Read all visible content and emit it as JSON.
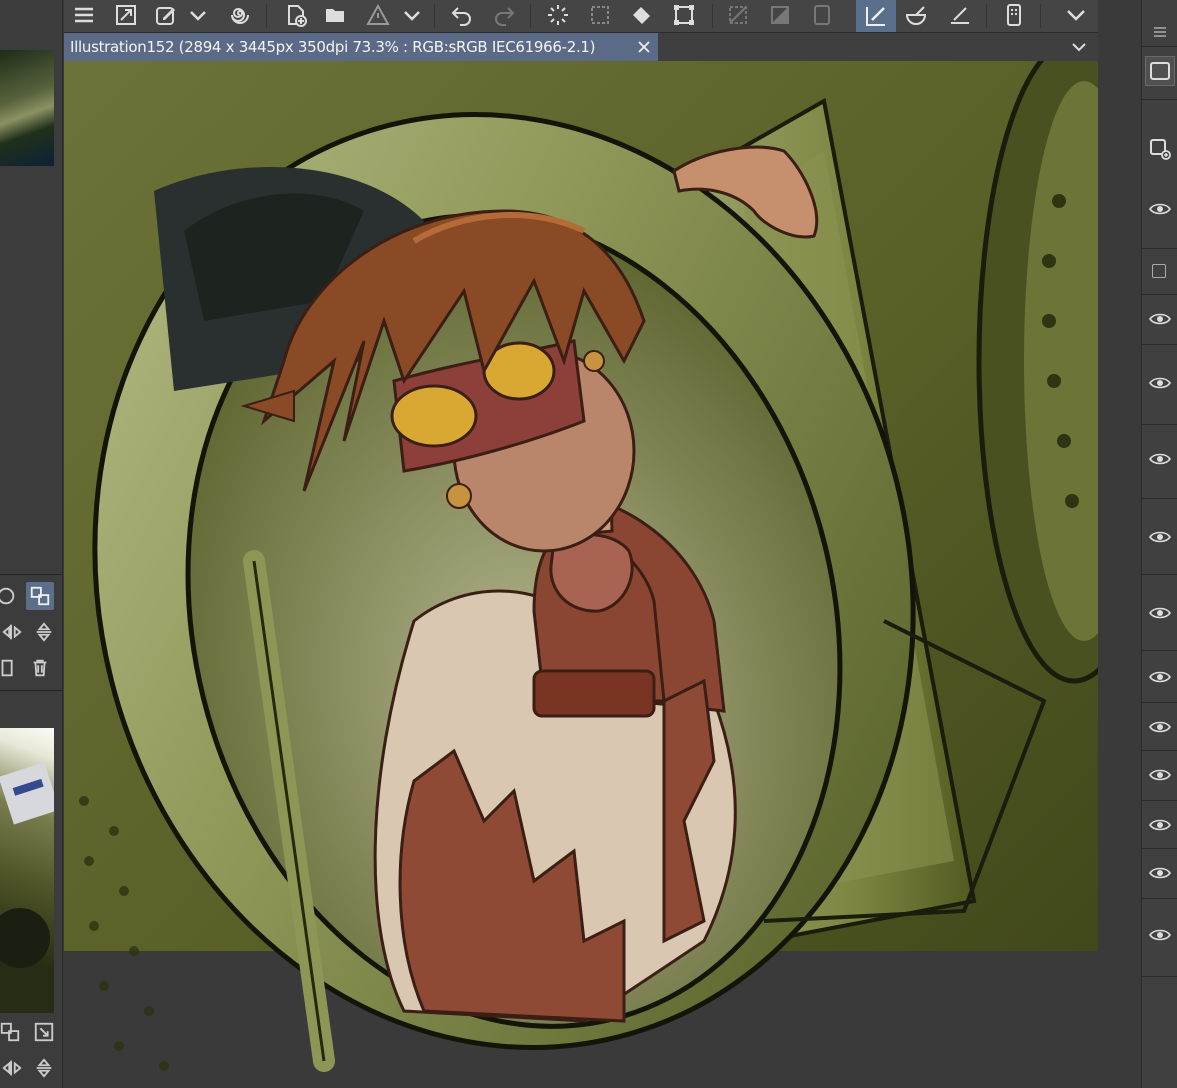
{
  "document": {
    "tab_title": "Illustration152 (2894 x 3445px 350dpi 73.3% : RGB:sRGB IEC61966-2.1)"
  },
  "toolbar": {
    "icons": [
      "menu-icon",
      "resize-icon",
      "edit-layer-icon",
      "dropdown-icon",
      "spiral-icon",
      "new-file-icon",
      "open-folder-icon",
      "warning-icon",
      "dropdown-icon",
      "undo-icon",
      "redo-icon",
      "loading-icon",
      "selection-icon",
      "fill-icon",
      "transform-icon",
      "deselect-icon",
      "gradient-icon",
      "frame-icon",
      "ruler-pen-icon",
      "bowl-icon",
      "ruler-icon",
      "phone-icon",
      "chevron-down-icon"
    ]
  },
  "layers_panel": {
    "rows": [
      "visible",
      "visible",
      "empty",
      "visible",
      "visible",
      "visible",
      "visible",
      "visible",
      "visible",
      "visible",
      "visible",
      "visible",
      "visible",
      "visible"
    ]
  },
  "colors": {
    "accent": "#5b6b87",
    "active_tool": "#5a6f8c",
    "panel_bg": "#3c3c3c"
  }
}
